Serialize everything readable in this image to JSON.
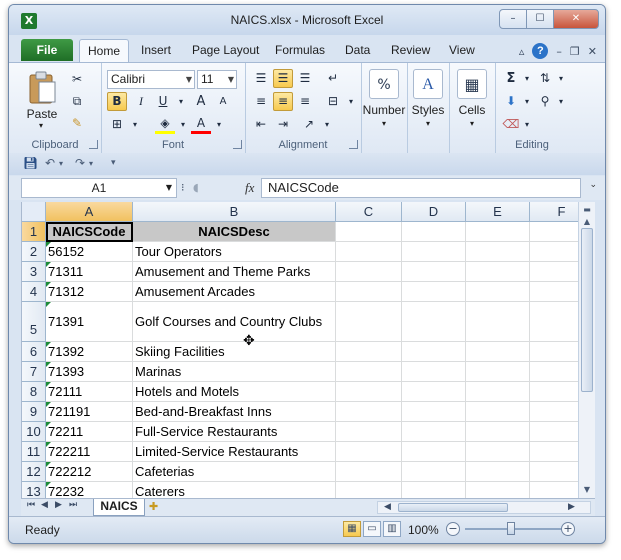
{
  "window": {
    "title": "NAICS.xlsx - Microsoft Excel",
    "app_icon": "X",
    "min_glyph": "–",
    "max_glyph": "☐",
    "close_glyph": "✕"
  },
  "ribbon_tabs": {
    "file": "File",
    "tabs": [
      "Home",
      "Insert",
      "Page Layout",
      "Formulas",
      "Data",
      "Review",
      "View"
    ],
    "active": "Home"
  },
  "clipboard": {
    "paste_label": "Paste",
    "group_label": "Clipboard"
  },
  "font": {
    "font_name": "Calibri",
    "font_size": "11",
    "bold_glyph": "B",
    "italic_glyph": "I",
    "underline_glyph": "U",
    "grow_glyph": "A",
    "shrink_glyph": "A",
    "font_color_glyph": "A",
    "group_label": "Font",
    "fill_color": "#ffff00",
    "font_color": "#ff0000"
  },
  "alignment": {
    "group_label": "Alignment"
  },
  "number": {
    "label": "Number",
    "glyph": "%"
  },
  "styles": {
    "label": "Styles",
    "glyph": "A"
  },
  "cells": {
    "label": "Cells"
  },
  "editing": {
    "group_label": "Editing",
    "sum_glyph": "Σ"
  },
  "formula_bar": {
    "name_box": "A1",
    "fx": "fx",
    "content": "NAICSCode"
  },
  "columns": [
    "A",
    "B",
    "C",
    "D",
    "E",
    "F"
  ],
  "rows": [
    {
      "num": "1",
      "a": "NAICSCode",
      "b": "NAICSDesc"
    },
    {
      "num": "2",
      "a": "56152",
      "b": "Tour Operators"
    },
    {
      "num": "3",
      "a": "71311",
      "b": "Amusement and Theme Parks"
    },
    {
      "num": "4",
      "a": "71312",
      "b": "Amusement Arcades"
    },
    {
      "num": "5",
      "a": "71391",
      "b": "Golf Courses and Country Clubs"
    },
    {
      "num": "6",
      "a": "71392",
      "b": "Skiing Facilities"
    },
    {
      "num": "7",
      "a": "71393",
      "b": "Marinas"
    },
    {
      "num": "8",
      "a": "72111",
      "b": "Hotels and Motels"
    },
    {
      "num": "9",
      "a": "721191",
      "b": "Bed-and-Breakfast Inns"
    },
    {
      "num": "10",
      "a": "72211",
      "b": "Full-Service Restaurants"
    },
    {
      "num": "11",
      "a": "722211",
      "b": "Limited-Service Restaurants"
    },
    {
      "num": "12",
      "a": "722212",
      "b": "Cafeterias"
    },
    {
      "num": "13",
      "a": "72232",
      "b": "Caterers"
    }
  ],
  "sheet_tabs": {
    "active": "NAICS"
  },
  "status": {
    "ready": "Ready",
    "zoom": "100%",
    "zoom_percent": 100
  }
}
